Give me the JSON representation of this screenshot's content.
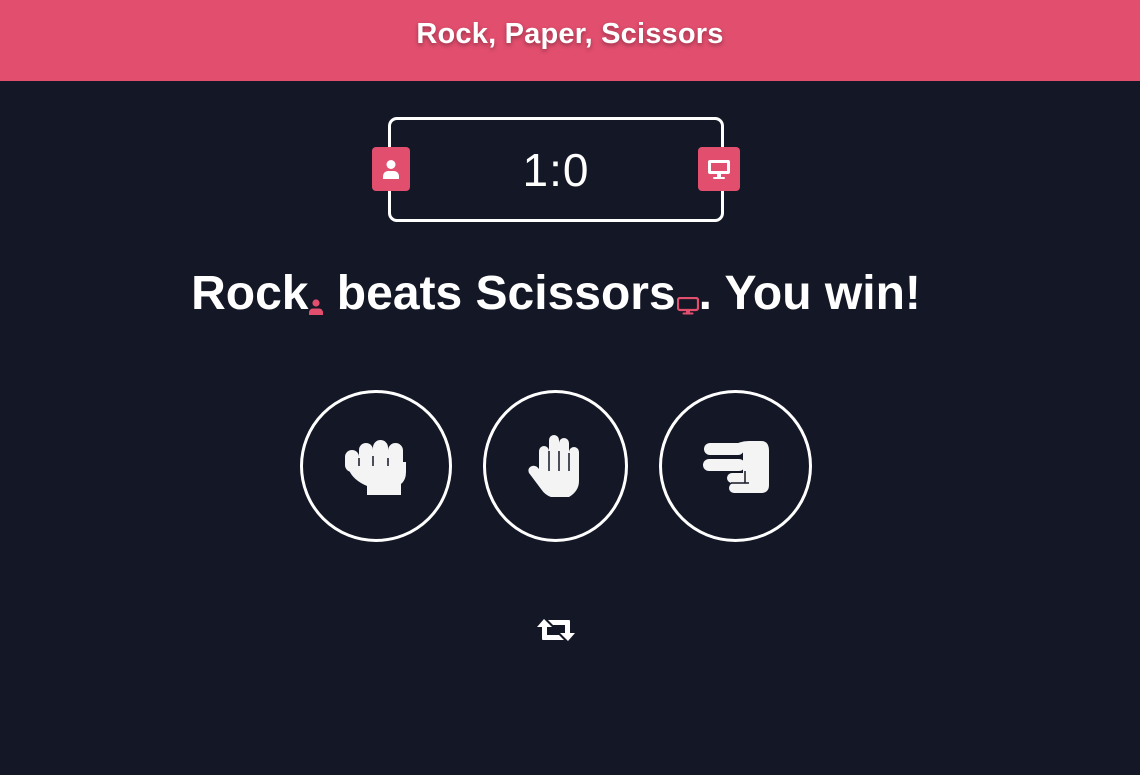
{
  "header": {
    "title": "Rock, Paper, Scissors"
  },
  "scoreboard": {
    "score": "1:0",
    "player_icon": "user-icon",
    "computer_icon": "desktop-icon"
  },
  "result": {
    "player_move": "Rock",
    "verb": " beats ",
    "computer_move": "Scissors",
    "outcome": ". You win!"
  },
  "choices": [
    {
      "label": "rock",
      "icon": "hand-rock-icon"
    },
    {
      "label": "paper",
      "icon": "hand-paper-icon"
    },
    {
      "label": "scissors",
      "icon": "hand-scissors-icon"
    }
  ],
  "controls": {
    "restart_icon": "retweet-icon"
  },
  "colors": {
    "accent": "#e24e6e",
    "background": "#141826",
    "foreground": "#ffffff"
  }
}
